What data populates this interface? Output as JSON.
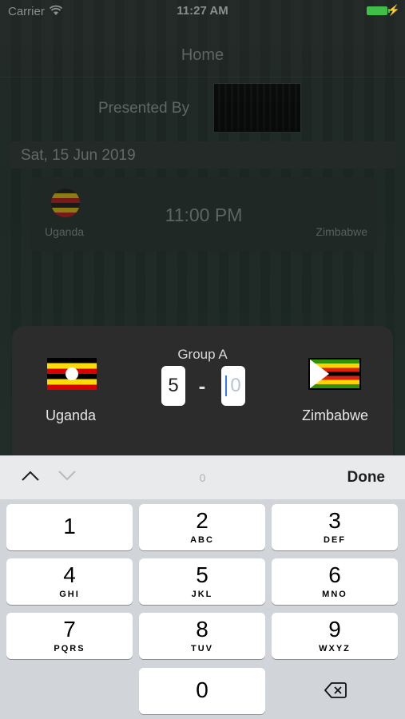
{
  "status_bar": {
    "carrier": "Carrier",
    "time": "11:27 AM"
  },
  "nav": {
    "title": "Home"
  },
  "sponsor": {
    "presented_by": "Presented By"
  },
  "fixture": {
    "date": "Sat, 15 Jun 2019",
    "time": "11:00 PM",
    "home_team": "Uganda",
    "away_team": "Zimbabwe"
  },
  "prediction": {
    "group": "Group A",
    "home_team": "Uganda",
    "away_team": "Zimbabwe",
    "home_score": "5",
    "dash": "-",
    "away_score_placeholder": "0"
  },
  "keyboard": {
    "accessory": {
      "field_preview": "0",
      "done_label": "Done"
    },
    "keys": [
      {
        "digit": "1",
        "letters": ""
      },
      {
        "digit": "2",
        "letters": "ABC"
      },
      {
        "digit": "3",
        "letters": "DEF"
      },
      {
        "digit": "4",
        "letters": "GHI"
      },
      {
        "digit": "5",
        "letters": "JKL"
      },
      {
        "digit": "6",
        "letters": "MNO"
      },
      {
        "digit": "7",
        "letters": "PQRS"
      },
      {
        "digit": "8",
        "letters": "TUV"
      },
      {
        "digit": "9",
        "letters": "WXYZ"
      },
      {
        "digit": "0",
        "letters": ""
      }
    ]
  },
  "colors": {
    "accent_cursor": "#3478f6",
    "battery": "#3fbf4a",
    "sheet_background": "#2c2c2d",
    "keyboard_background": "#d1d4d9"
  }
}
